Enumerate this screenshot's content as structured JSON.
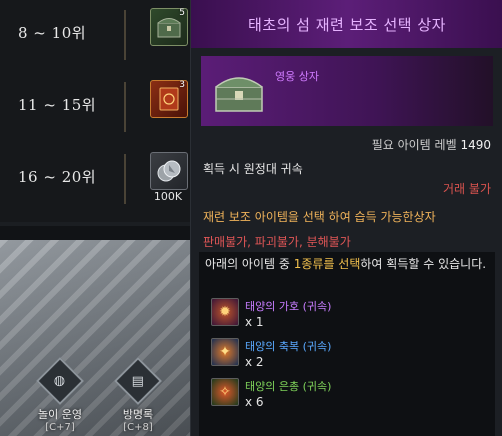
{
  "rank_list": [
    {
      "rank": "8 ~ 10위",
      "count": "5",
      "icon": "chest-icon",
      "slot_color": "green"
    },
    {
      "rank": "11 ~ 15위",
      "count": "3",
      "icon": "book-icon",
      "slot_color": "orange"
    },
    {
      "rank": "16 ~ 20위",
      "bottom_label": "100K",
      "icon": "silver-coins-icon",
      "slot_color": "gray"
    }
  ],
  "scene": {
    "buttons": [
      {
        "label": "놀이 운영",
        "key": "[C+7]",
        "icon": "gauge-icon"
      },
      {
        "label": "방명록",
        "key": "[C+8]",
        "icon": "guestbook-icon"
      }
    ]
  },
  "tooltip": {
    "title": "태초의 섬 재련 보조 선택 상자",
    "grade": "영웅 상자",
    "required_level_label": "필요 아이템 레벨",
    "required_level": "1490",
    "bind_text": "획득 시 원정대 귀속",
    "trade_text": "거래 불가",
    "description": "재련 보조 아이템을 선택 하여 습득 가능한상자",
    "restrictions": "판매불가, 파괴불가, 분해불가",
    "choose_prefix": "아래의 아이템 중 ",
    "choose_highlight": "1종류를 선택",
    "choose_suffix": "하여 획득할 수 있습니다.",
    "rewards": [
      {
        "name": "태양의 가호 (귀속)",
        "qty": "x 1",
        "color": "#c77dff",
        "icon": "sun-blessing-icon"
      },
      {
        "name": "태양의 축복 (귀속)",
        "qty": "x 2",
        "color": "#5aa9ff",
        "icon": "sun-grace-icon"
      },
      {
        "name": "태양의 은총 (귀속)",
        "qty": "x 6",
        "color": "#7fd35a",
        "icon": "sun-favor-icon"
      }
    ]
  }
}
